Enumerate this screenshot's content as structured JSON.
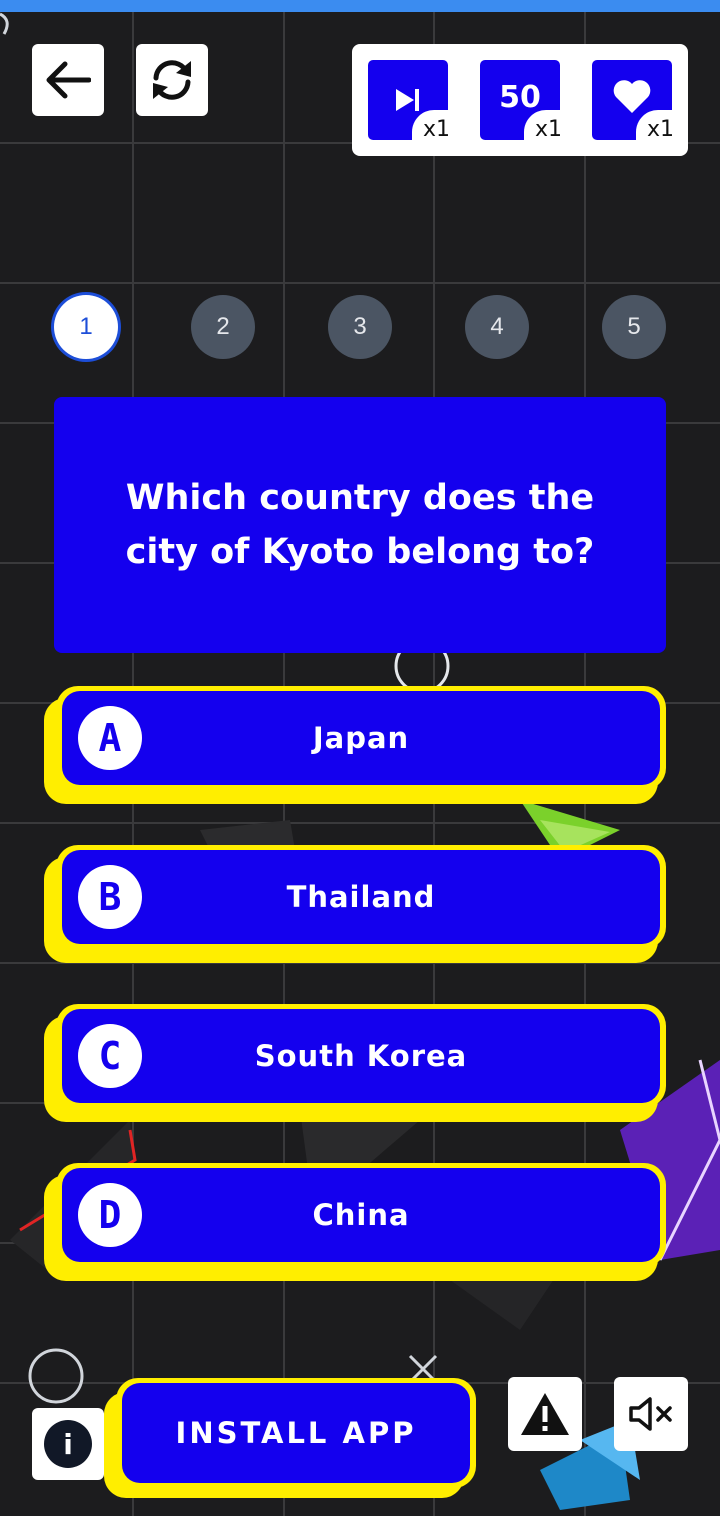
{
  "header": {
    "back_icon": "arrow-left-icon",
    "refresh_icon": "refresh-icon",
    "powerups": [
      {
        "name": "skip",
        "icon": "skip-next-icon",
        "text": "",
        "count": "x1"
      },
      {
        "name": "fifty-fifty",
        "icon": "",
        "text": "50",
        "count": "x1"
      },
      {
        "name": "extra-life",
        "icon": "heart-icon",
        "text": "",
        "count": "x1"
      }
    ]
  },
  "progress": {
    "steps": [
      "1",
      "2",
      "3",
      "4",
      "5"
    ],
    "current": "1"
  },
  "question": {
    "text": "Which country does the city of Kyoto belong to?"
  },
  "answers": [
    {
      "letter": "A",
      "label": "Japan"
    },
    {
      "letter": "B",
      "label": "Thailand"
    },
    {
      "letter": "C",
      "label": "South Korea"
    },
    {
      "letter": "D",
      "label": "China"
    }
  ],
  "footer": {
    "info_label": "i",
    "install_label": "INSTALL APP",
    "report_icon": "warning-icon",
    "mute_icon": "speaker-mute-icon"
  },
  "colors": {
    "accent_blue": "#1400ee",
    "accent_yellow": "#ffee00",
    "background": "#1c1c1e",
    "step_inactive": "#4b5563"
  }
}
